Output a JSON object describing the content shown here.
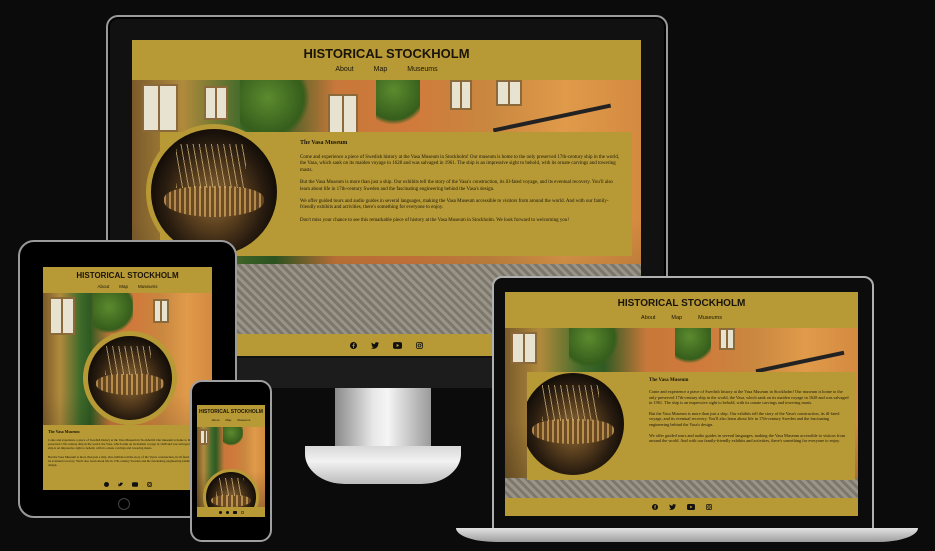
{
  "site": {
    "title": "HISTORICAL STOCKHOLM",
    "nav": [
      "About",
      "Map",
      "Museums"
    ],
    "card_heading": "The Vasa Museum",
    "paragraphs": [
      "Come and experience a piece of Swedish history at the Vasa Museum in Stockholm! Our museum is home to the only preserved 17th-century ship in the world, the Vasa, which sank on its maiden voyage in 1628 and was salvaged in 1961. The ship is an impressive sight to behold, with its ornate carvings and towering masts.",
      "But the Vasa Museum is more than just a ship. Our exhibits tell the story of the Vasa's construction, its ill-fated voyage, and its eventual recovery. You'll also learn about life in 17th-century Sweden and the fascinating engineering behind the Vasa's design.",
      "We offer guided tours and audio guides in several languages, making the Vasa Museum accessible to visitors from around the world. And with our family-friendly exhibits and activities, there's something for everyone to enjoy.",
      "Don't miss your chance to see this remarkable piece of history at the Vasa Museum in Stockholm. We look forward to welcoming you!"
    ],
    "social_icons": [
      "facebook-icon",
      "twitter-icon",
      "youtube-icon",
      "instagram-icon"
    ],
    "colors": {
      "gold": "#b79a36",
      "text": "#1a1408",
      "backdrop": "#0b0b0b"
    }
  }
}
